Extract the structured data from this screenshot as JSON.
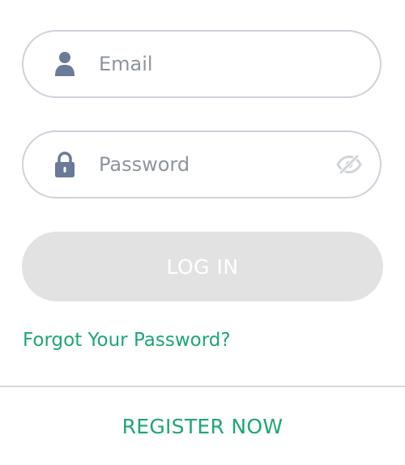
{
  "form": {
    "email": {
      "placeholder": "Email",
      "value": "",
      "icon": "user-icon"
    },
    "password": {
      "placeholder": "Password",
      "value": "",
      "icon": "lock-icon",
      "toggle_icon": "eye-off-icon"
    },
    "login_label": "LOG IN",
    "forgot_label": "Forgot Your Password?",
    "register_label": "REGISTER NOW"
  },
  "colors": {
    "accent": "#1ea672",
    "icon": "#6b7a99",
    "border": "#cdd2da",
    "placeholder": "#8e949e",
    "button_disabled_bg": "#e2e2e2",
    "eye_icon": "#d0d4da"
  }
}
